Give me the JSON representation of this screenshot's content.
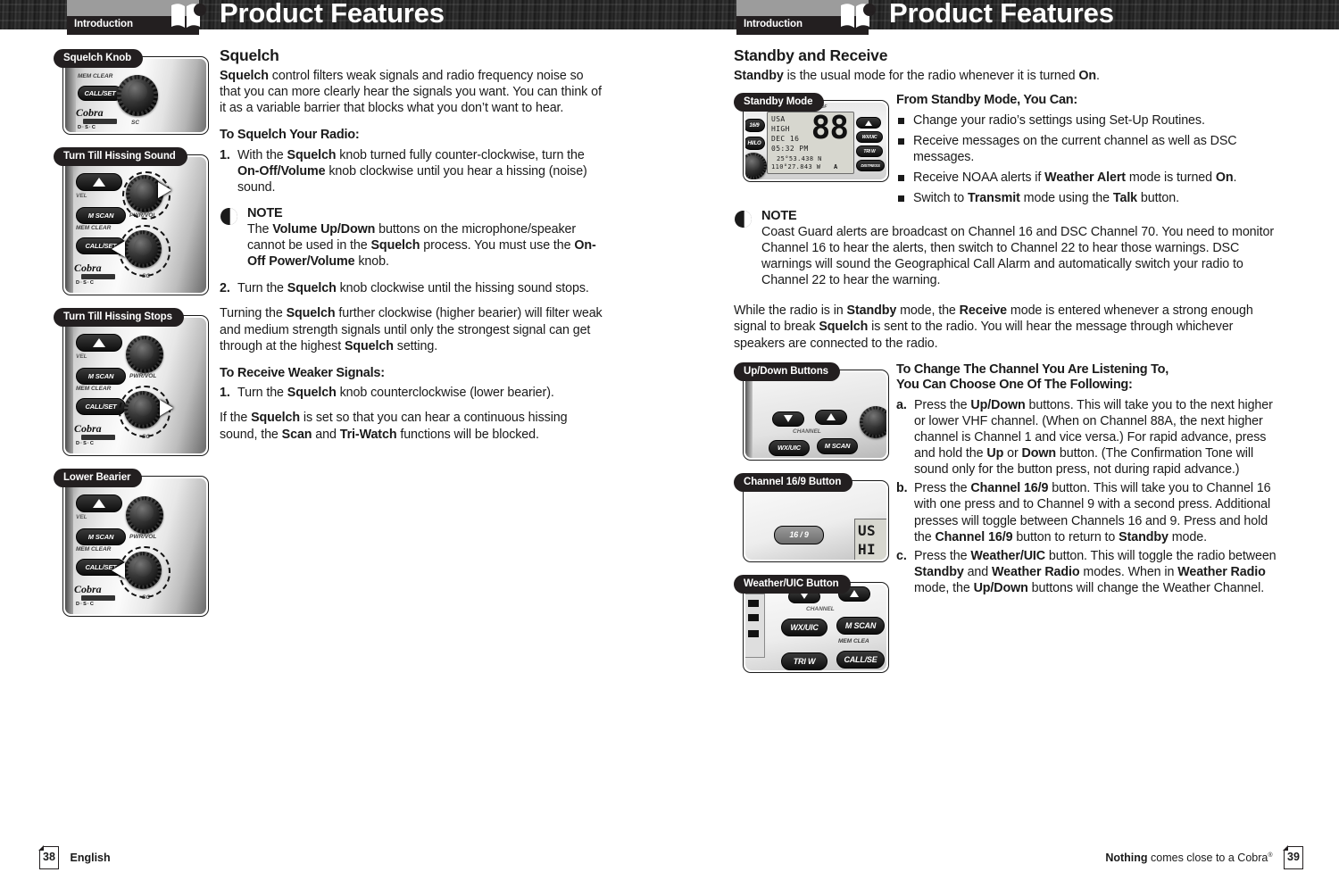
{
  "spread": {
    "header_title": "Product Features",
    "chapter_tab": "Introduction",
    "book_icon": "open-book-icon"
  },
  "left_page": {
    "figures": [
      {
        "callout": "Squelch Knob",
        "radio_labels": [
          "MEM CLEAR",
          "CALL/SET",
          "SC"
        ],
        "brand": "Cobra",
        "brand_sub": "D·S·C",
        "brand_band": "marine"
      },
      {
        "callout": "Turn Till Hissing Sound",
        "radio_labels": [
          "VEL",
          "M SCAN",
          "MEM CLEAR",
          "CALL/SET",
          "PWR/VOL",
          "SC"
        ],
        "brand": "Cobra",
        "brand_sub": "D·S·C",
        "brand_band": "marine"
      },
      {
        "callout": "Turn Till Hissing Stops",
        "radio_labels": [
          "VEL",
          "M SCAN",
          "MEM CLEAR",
          "CALL/SET",
          "PWR/VOL",
          "SC"
        ],
        "brand": "Cobra",
        "brand_sub": "D·S·C",
        "brand_band": "marine"
      },
      {
        "callout": "Lower Bearier",
        "radio_labels": [
          "VEL",
          "M SCAN",
          "MEM CLEAR",
          "CALL/SET",
          "PWR/VOL",
          "SC"
        ],
        "brand": "Cobra",
        "brand_sub": "D·S·C",
        "brand_band": "marine"
      }
    ],
    "heading": "Squelch",
    "intro_html": "<b>Squelch</b> control filters weak signals and radio frequency noise so that you can more clearly hear the signals you want. You can think of it as a variable barrier that blocks what you don’t want to hear.",
    "subhead_1": "To Squelch Your Radio:",
    "step_1_marker": "1.",
    "step_1_html": "With the <b>Squelch</b> knob turned fully counter-clockwise, turn the <b>On-Off/Volume</b> knob clockwise until you hear a hissing (noise) sound.",
    "note_title": "NOTE",
    "note_html": "The <b>Volume Up/Down</b> buttons on the microphone/speaker cannot be used in the <b>Squelch</b> process. You must use the <b>On-Off Power/Volume</b> knob.",
    "step_2_marker": "2.",
    "step_2_html": "Turn the <b>Squelch</b> knob clockwise until the hissing sound stops.",
    "para_2_html": "Turning the <b>Squelch</b> further clockwise (higher bearier) will filter weak and medium strength signals until only the strongest signal can get through at the highest <b>Squelch</b> setting.",
    "subhead_2": "To Receive Weaker Signals:",
    "step_3_marker": "1.",
    "step_3_html": "Turn the <b>Squelch</b> knob counterclockwise (lower bearier).",
    "para_3_html": "If the <b>Squelch</b> is set so that you can hear a continuous hissing sound, the <b>Scan</b> and <b>Tri-Watch</b> functions will be blocked.",
    "footer_page": "38",
    "footer_text": "English"
  },
  "right_page": {
    "heading": "Standby and Receive",
    "intro_html": "<b>Standby</b> is the usual mode for the radio whenever it is turned <b>On</b>.",
    "figure_standby": {
      "callout": "Standby Mode",
      "lcd": {
        "line1": "USA",
        "line2": "HIGH",
        "line3": "DEC 16",
        "line4": "05:32 PM",
        "channel": "88",
        "lat": "25°53.438 N",
        "lon": "110°27.843 W",
        "lon_suffix": "A"
      },
      "side_labels": [
        "16/9",
        "HI/LO",
        "WX/UIC",
        "TRI W",
        "DISTRESS"
      ],
      "top_label": "WATERPROOF"
    },
    "list_heading": "From Standby Mode, You Can:",
    "bullets_html": [
      "Change your radio’s settings using Set-Up Routines.",
      "Receive messages on the current channel as well as DSC messages.",
      "Receive NOAA alerts if <b>Weather Alert</b> mode is turned <b>On</b>.",
      "Switch to <b>Transmit</b> mode using the <b>Talk</b> button."
    ],
    "note_title": "NOTE",
    "note_html": "Coast Guard alerts are broadcast on Channel 16 and DSC Channel 70. You need to monitor Channel 16 to hear the alerts, then switch to Channel 22 to hear those warnings. DSC warnings will sound the Geographical Call Alarm and automatically switch your radio to Channel 22 to hear the warning.",
    "para_html": "While the radio is in <b>Standby</b> mode, the <b>Receive</b> mode is entered whenever a strong enough signal to break <b>Squelch</b> is sent to the radio. You will hear the message through whichever speakers are connected to the radio.",
    "change_heading_line1": "To Change The Channel You Are Listening To,",
    "change_heading_line2": "You Can Choose One Of The Following:",
    "figures": [
      {
        "callout": "Up/Down Buttons",
        "labels": [
          "CHANNEL",
          "WX/UIC",
          "M SCAN"
        ]
      },
      {
        "callout": "Channel 16/9 Button",
        "labels": [
          "16 / 9",
          "US",
          "HI"
        ]
      },
      {
        "callout": "Weather/UIC Button",
        "labels": [
          "CHANNEL",
          "WX/UIC",
          "M SCAN",
          "MEM CLEA",
          "TRI W",
          "CALL/SE"
        ]
      }
    ],
    "items": [
      {
        "marker": "a.",
        "html": "Press the <b>Up/Down</b> buttons. This will take you to the next higher or lower VHF channel. (When on Channel 88A, the next higher channel is Channel 1 and vice versa.) For rapid advance, press and hold the <b>Up</b> or <b>Down</b> button. (The Confirmation Tone will sound only for the button press, not during rapid advance.)"
      },
      {
        "marker": "b.",
        "html": "Press the <b>Channel 16/9</b> button. This will take you to Channel 16 with one press and to Channel 9 with a second press. Additional presses will toggle between Channels 16 and 9. Press and hold the <b>Channel 16/9</b> button to return to <b>Standby</b> mode."
      },
      {
        "marker": "c.",
        "html": "Press the <b>Weather/UIC</b> button. This will toggle the radio between <b>Standby</b> and <b>Weather Radio</b> modes. When in <b>Weather Radio</b> mode, the <b>Up/Down</b> buttons will change the Weather Channel."
      }
    ],
    "footer_page": "39",
    "footer_text_html": "<b>Nothing</b> comes close to a Cobra<span class=\"sup\">®</span>"
  },
  "colors": {
    "ink": "#1a1a1a",
    "tab_black": "#231f20",
    "tab_grey": "#9c9c9c",
    "header_dark": "#2b2b2b",
    "lcd_bg": "#d7d7cf"
  }
}
